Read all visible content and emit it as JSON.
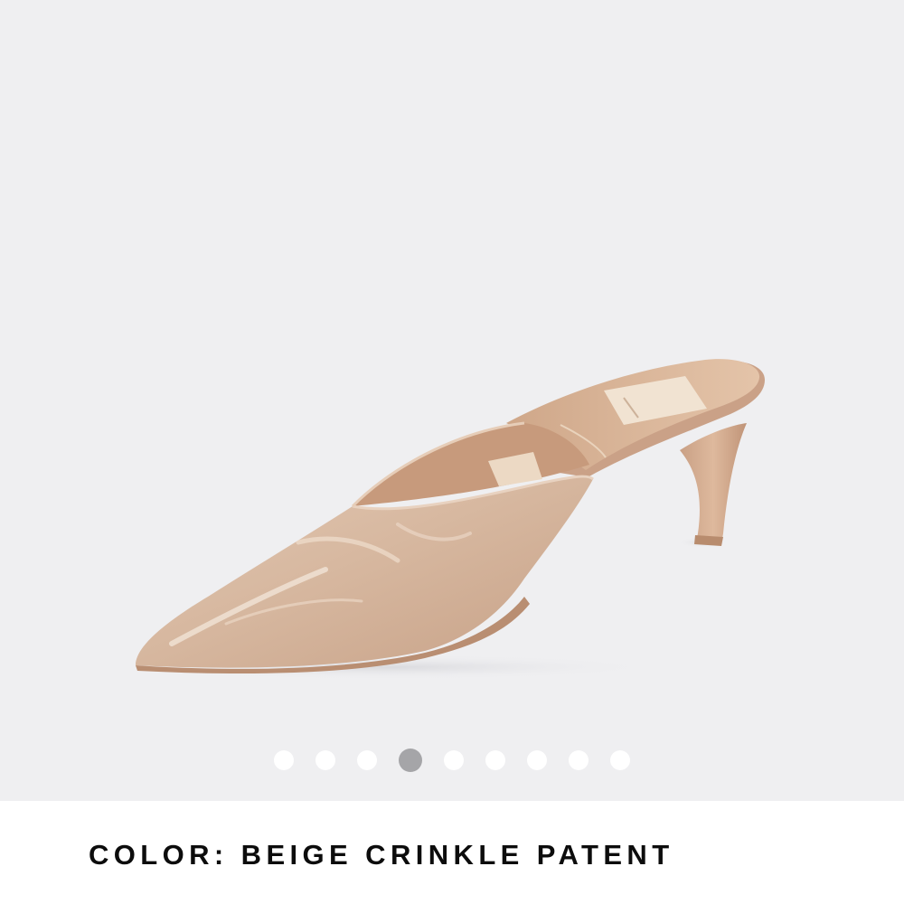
{
  "gallery": {
    "image_subject": "beige crinkle patent pointed-toe kitten-heel mule",
    "slide_count": 9,
    "active_slide": 4,
    "colors": {
      "background": "#efeff1",
      "dot": "#ffffff",
      "dot_active": "#a5a5a8",
      "shoe": "#d7b9a1"
    }
  },
  "color": {
    "label": "COLOR: BEIGE CRINKLE PATENT"
  }
}
